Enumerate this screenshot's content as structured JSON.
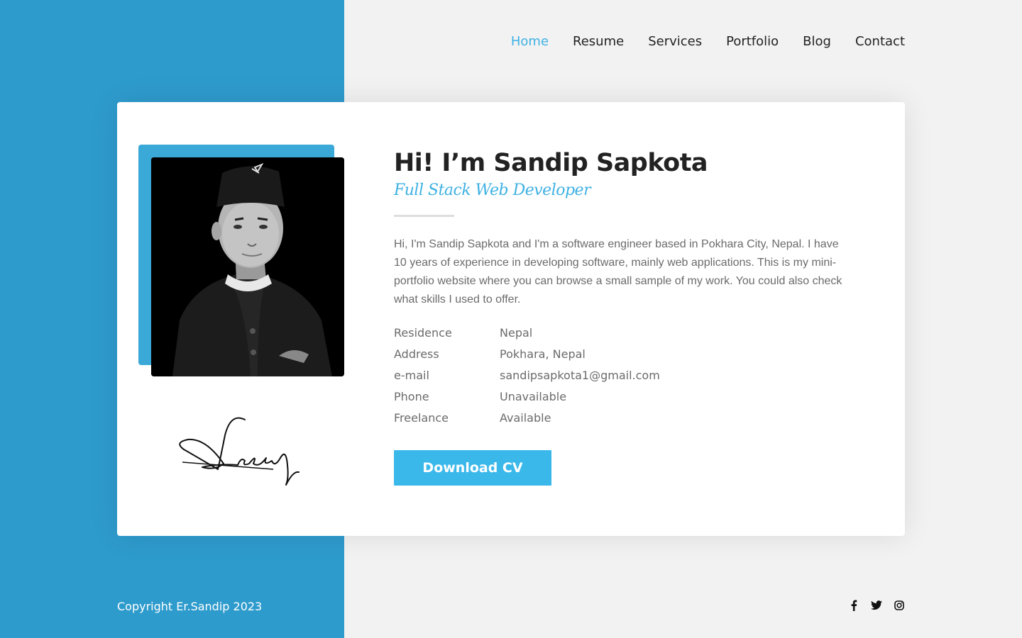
{
  "nav": {
    "items": [
      {
        "label": "Home",
        "active": true
      },
      {
        "label": "Resume",
        "active": false
      },
      {
        "label": "Services",
        "active": false
      },
      {
        "label": "Portfolio",
        "active": false
      },
      {
        "label": "Blog",
        "active": false
      },
      {
        "label": "Contact",
        "active": false
      }
    ]
  },
  "profile": {
    "name": "Hi! I’m Sandip Sapkota",
    "role": "Full Stack Web Developer",
    "bio": "Hi, I'm Sandip Sapkota and I'm a software engineer based in Pokhara City, Nepal. I have 10 years of experience in developing software, mainly web applications. This is my mini-portfolio website where you can browse a small sample of my work. You could also check what skills I used to offer.",
    "details": [
      {
        "label": "Residence",
        "value": "Nepal"
      },
      {
        "label": "Address",
        "value": "Pokhara, Nepal"
      },
      {
        "label": "e-mail",
        "value": "sandipsapkota1@gmail.com"
      },
      {
        "label": "Phone",
        "value": "Unavailable"
      },
      {
        "label": "Freelance",
        "value": "Available"
      }
    ],
    "cv_button": "Download CV",
    "signature_text": "Sandeep"
  },
  "footer": {
    "copyright": "Copyright Er.Sandip 2023",
    "socials": [
      "facebook-icon",
      "twitter-icon",
      "instagram-icon"
    ]
  },
  "colors": {
    "accent": "#3fb1e3",
    "sidebar_blue": "#2e9bcd",
    "button": "#3bb8ea"
  }
}
